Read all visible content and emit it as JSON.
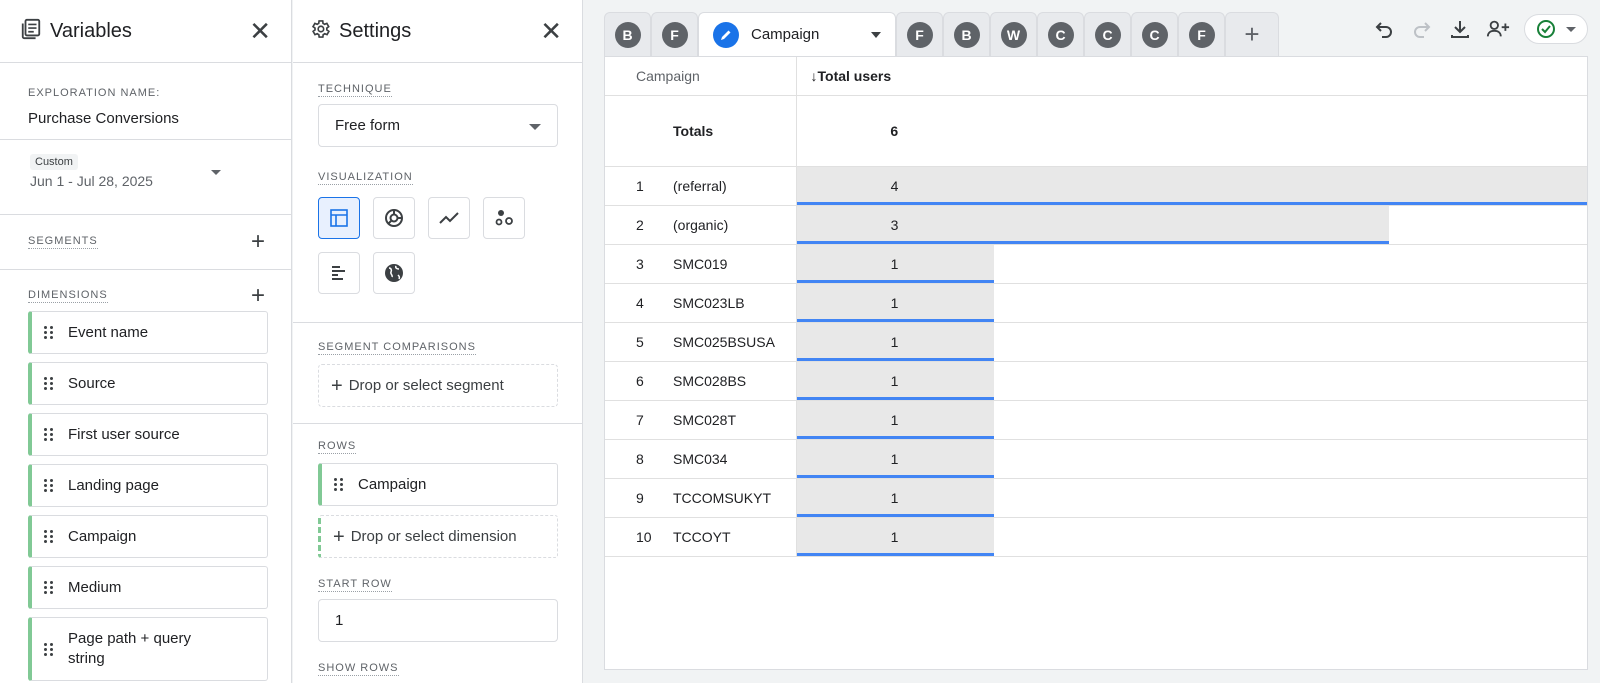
{
  "variables": {
    "title": "Variables",
    "exploration_label": "EXPLORATION NAME:",
    "exploration_name": "Purchase Conversions",
    "date_chip": "Custom",
    "date_range": "Jun 1 - Jul 28, 2025",
    "segments_label": "SEGMENTS",
    "dimensions_label": "DIMENSIONS",
    "dimensions": [
      "Event name",
      "Source",
      "First user source",
      "Landing page",
      "Campaign",
      "Medium",
      "Page path + query string"
    ]
  },
  "settings": {
    "title": "Settings",
    "technique_label": "TECHNIQUE",
    "technique_value": "Free form",
    "visualization_label": "VISUALIZATION",
    "segment_comparisons_label": "SEGMENT COMPARISONS",
    "segment_drop": "Drop or select segment",
    "rows_label": "ROWS",
    "row_item": "Campaign",
    "row_drop": "Drop or select dimension",
    "start_row_label": "START ROW",
    "start_row_value": "1",
    "show_rows_label": "SHOW ROWS"
  },
  "tabs": {
    "before": [
      "B",
      "F"
    ],
    "active_label": "Campaign",
    "after": [
      "F",
      "B",
      "W",
      "C",
      "C",
      "C",
      "F"
    ]
  },
  "table": {
    "dim_header": "Campaign",
    "metric_header": "↓Total users",
    "totals_label": "Totals",
    "totals_value": "6",
    "max_value": 4,
    "rows": [
      {
        "idx": "1",
        "name": "(referral)",
        "value": 4
      },
      {
        "idx": "2",
        "name": "(organic)",
        "value": 3
      },
      {
        "idx": "3",
        "name": "SMC019",
        "value": 1
      },
      {
        "idx": "4",
        "name": "SMC023LB",
        "value": 1
      },
      {
        "idx": "5",
        "name": "SMC025BSUSA",
        "value": 1
      },
      {
        "idx": "6",
        "name": "SMC028BS",
        "value": 1
      },
      {
        "idx": "7",
        "name": "SMC028T",
        "value": 1
      },
      {
        "idx": "8",
        "name": "SMC034",
        "value": 1
      },
      {
        "idx": "9",
        "name": "TCCOMSUKYT",
        "value": 1
      },
      {
        "idx": "10",
        "name": "TCCOYT",
        "value": 1
      }
    ]
  },
  "colors": {
    "accent": "#1a73e8",
    "dimension_border": "#81c995",
    "bar": "#e8e8e8",
    "bar_line": "#4285f4",
    "status_ok": "#188038"
  }
}
